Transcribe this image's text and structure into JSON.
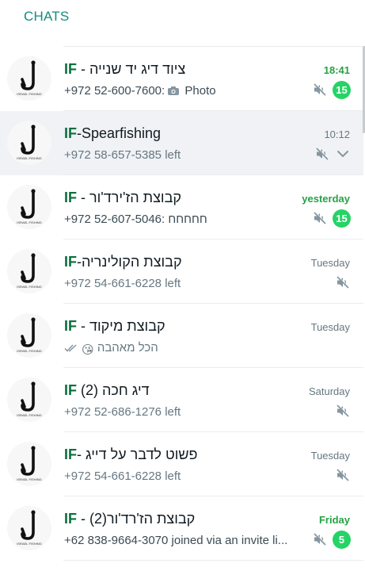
{
  "header": {
    "title": "CHATS"
  },
  "logo": {
    "label": "ISRAEL FISHING"
  },
  "colors": {
    "accent": "#128C7E",
    "brand": "#0b6e3e",
    "unread": "#25d366",
    "selected_row": "#f0f2f5"
  },
  "chats": [
    {
      "brand": "IF",
      "sep": " -",
      "name": "ציוד דיג יד שנייה",
      "name_first": true,
      "time": "18:41",
      "time_unread": true,
      "preview_prefix": "+972 52-600-7600:",
      "preview_icon": "camera-icon",
      "preview_text": "Photo",
      "muted": true,
      "badge": "15"
    },
    {
      "brand": "IF",
      "sep": "-",
      "name": "Spearfishing",
      "name_first": false,
      "time": "10:12",
      "time_unread": false,
      "preview_prefix": "+972 58-657-5385 left",
      "preview_text": "",
      "muted": true,
      "chevron": true,
      "selected": true,
      "light": true
    },
    {
      "brand": "IF",
      "sep": " -",
      "name": "קבוצת הז'ירד'ור",
      "name_first": true,
      "time": "yesterday",
      "time_unread": true,
      "preview_prefix": "+972 52-607-5046:",
      "preview_text": "חחחחח",
      "preview_rtl": true,
      "muted": true,
      "badge": "15"
    },
    {
      "brand": "IF",
      "sep": "-",
      "name": "קבוצת הקולינריה",
      "name_first": false,
      "time": "Tuesday",
      "time_unread": false,
      "preview_prefix": "+972 54-661-6228 left",
      "preview_text": "",
      "muted": true,
      "light": true
    },
    {
      "brand": "IF",
      "sep": " - ",
      "name": "קבוצת מיקוד",
      "name_first": false,
      "time": "Tuesday",
      "time_unread": false,
      "preview_prefix": "",
      "preview_ticks": true,
      "preview_emoji": "😘",
      "preview_text": "הכל מאהבה",
      "preview_rtl": true,
      "muted": false,
      "light": true
    },
    {
      "brand": "IF",
      "sep": " (2) ",
      "name": "דיג חכה",
      "name_first": false,
      "time": "Saturday",
      "time_unread": false,
      "preview_prefix": "+972 52-686-1276 left",
      "preview_text": "",
      "muted": true,
      "light": true
    },
    {
      "brand": "IF",
      "sep": "- ",
      "name": "פשוט לדבר על דייג",
      "name_first": false,
      "time": "Tuesday",
      "time_unread": false,
      "preview_prefix": "+972 54-661-6228 left",
      "preview_text": "",
      "muted": true,
      "light": true
    },
    {
      "brand": "IF",
      "sep": " - ",
      "name": "קבוצת הז'רד'ור(2)",
      "name_first": false,
      "time": "Friday",
      "time_unread": true,
      "preview_prefix": "+62 838-9664-3070 joined via an invite li...",
      "preview_text": "",
      "muted": true,
      "badge": "5"
    }
  ]
}
